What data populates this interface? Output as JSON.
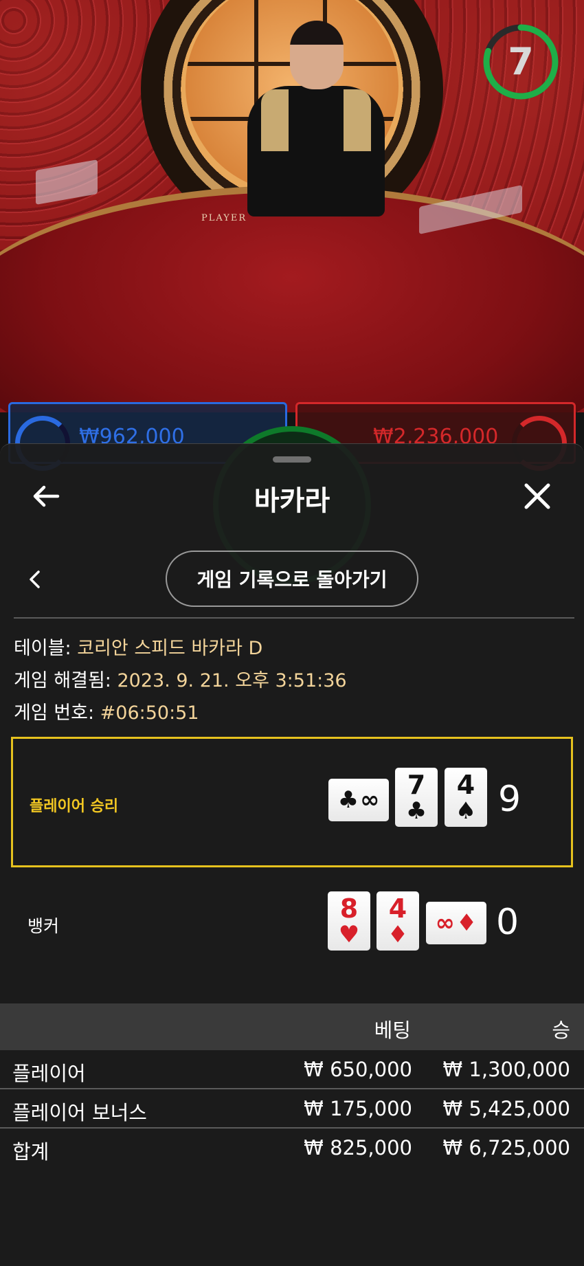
{
  "video": {
    "timer_value": "7",
    "timer_progress": 0.8,
    "felt_label": "PLAYER",
    "player_bet_peek": "₩962,000",
    "banker_bet_peek": "₩2,236,000"
  },
  "header": {
    "title": "바카라"
  },
  "nav": {
    "back_to_history_label": "게임 기록으로 돌아가기"
  },
  "info": {
    "table_label": "테이블:",
    "table_value": "코리안 스피드 바카라 D",
    "resolved_label": "게임 해결됨:",
    "resolved_value": "2023. 9. 21. 오후 3:51:36",
    "number_label": "게임 번호:",
    "number_value": "#06:50:51"
  },
  "hands": {
    "player": {
      "label": "플레이어 승리",
      "score": "9",
      "cards": [
        {
          "rank": "∞",
          "suit": "♣",
          "color": "#111111",
          "orientation": "sideways"
        },
        {
          "rank": "7",
          "suit": "♣",
          "color": "#111111",
          "orientation": "upright"
        },
        {
          "rank": "4",
          "suit": "♠",
          "color": "#111111",
          "orientation": "upright"
        }
      ]
    },
    "banker": {
      "label": "뱅커",
      "score": "0",
      "cards": [
        {
          "rank": "8",
          "suit": "♥",
          "color": "#d8202a",
          "orientation": "upright"
        },
        {
          "rank": "4",
          "suit": "♦",
          "color": "#d8202a",
          "orientation": "upright"
        },
        {
          "rank": "∞",
          "suit": "♦",
          "color": "#d8202a",
          "orientation": "sideways"
        }
      ]
    }
  },
  "results": {
    "headers": {
      "bet": "베팅",
      "win": "승"
    },
    "rows": [
      {
        "name": "플레이어",
        "bet": "₩ 650,000",
        "win": "₩ 1,300,000"
      },
      {
        "name": "플레이어 보너스",
        "bet": "₩ 175,000",
        "win": "₩ 5,425,000"
      },
      {
        "name": "합계",
        "bet": "₩ 825,000",
        "win": "₩ 6,725,000"
      }
    ]
  },
  "colors": {
    "accent_gold": "#f2c722",
    "value_text": "#f3d49a",
    "timer_ring": "#1fae48",
    "player_blue": "#2a6ae0",
    "banker_red": "#d4282a"
  },
  "icons": [
    "arrow-left-icon",
    "close-icon",
    "chevron-left-icon"
  ]
}
